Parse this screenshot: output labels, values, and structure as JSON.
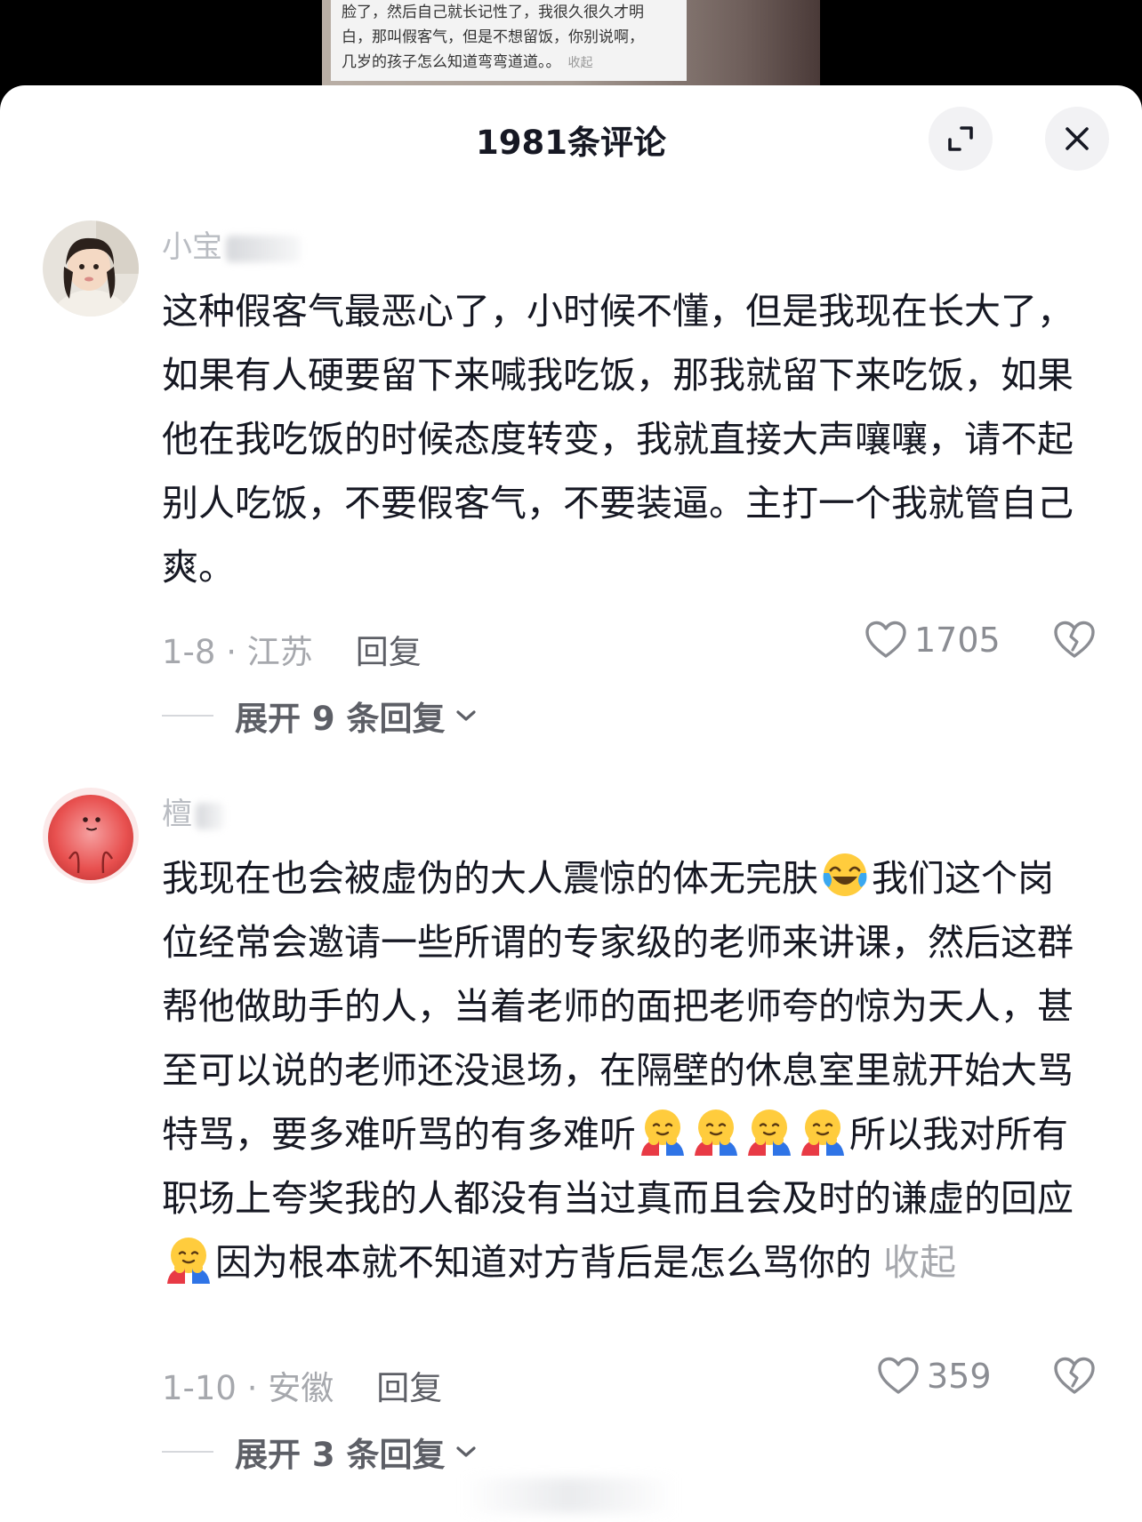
{
  "background": {
    "caption_lines": [
      "脸了，然后自己就长记性了，我很久很久才明",
      "白，那叫假客气，但是不想留饭，你别说啊，",
      "几岁的孩子怎么知道弯弯道道。。"
    ],
    "caption_fold": "收起"
  },
  "header": {
    "title": "1981条评论",
    "expand_icon": "expand-icon",
    "close_icon": "close-icon"
  },
  "comments": [
    {
      "username": "小宝",
      "text": "这种假客气最恶心了，小时候不懂，但是我现在长大了，如果有人硬要留下来喊我吃饭，那我就留下来吃饭，如果他在我吃饭的时候态度转变，我就直接大声嚷嚷，请不起别人吃饭，不要假客气，不要装逼。主打一个我就管自己爽。",
      "date_location": "1-8 · 江苏",
      "reply_label": "回复",
      "likes": "1705",
      "expand_label": "展开 9 条回复"
    },
    {
      "username": "檀",
      "text_segments": [
        "我现在也会被虚伪的大人震惊的体无完肤",
        "我们这个岗位经常会邀请一些所谓的专家级的老师来讲课，然后这群帮他做助手的人，当着老师的面把老师夸的惊为天人，甚至可以说的老师还没退场，在隔壁的休息室里就开始大骂特骂，要多难听骂的有多难听",
        "所以我对所有职场上夸奖我的人都没有当过真而且会及时的谦虚的回应",
        "因为根本就不知道对方背后是怎么骂你的"
      ],
      "fold_label": "收起",
      "date_location": "1-10 · 安徽",
      "reply_label": "回复",
      "likes": "359",
      "expand_label": "展开 3 条回复"
    }
  ],
  "colors": {
    "text_primary": "#161823",
    "text_secondary": "#a6a8ad",
    "reply_text": "#5d5f66",
    "sheet_bg": "#ffffff",
    "button_bg": "#f2f2f4"
  }
}
